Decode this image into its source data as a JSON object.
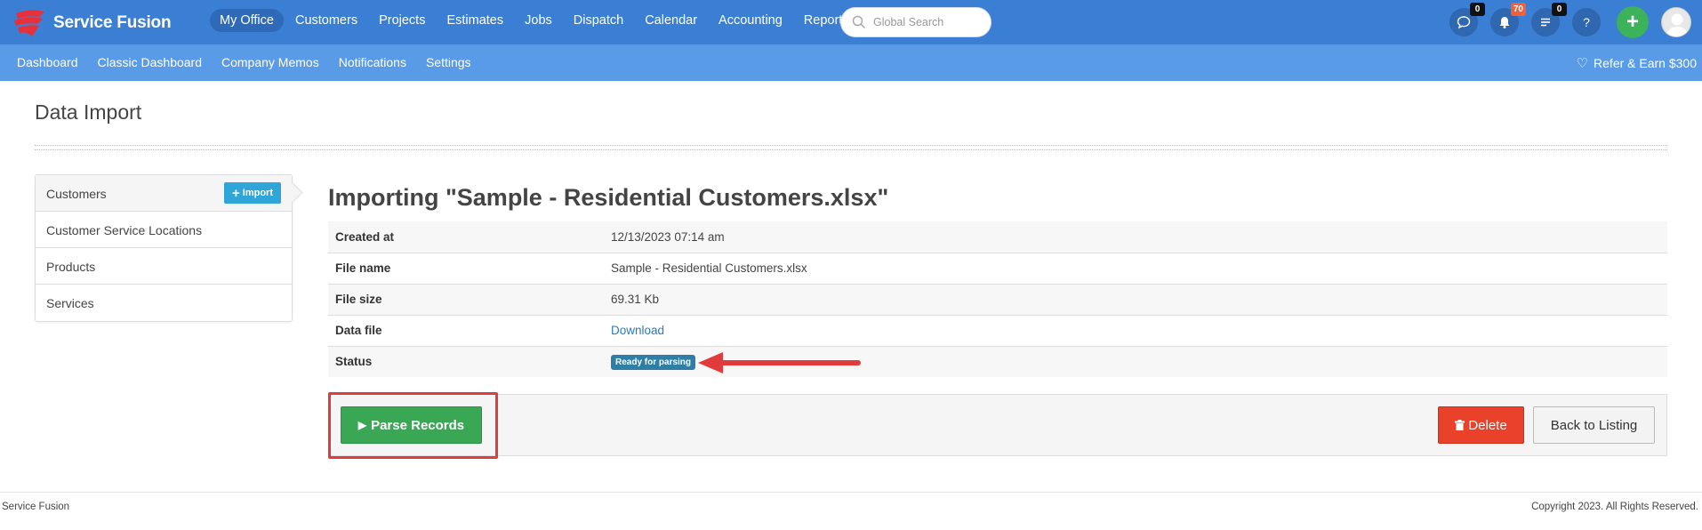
{
  "brand": {
    "name": "Service Fusion"
  },
  "main_nav": [
    {
      "label": "My Office",
      "active": true
    },
    {
      "label": "Customers"
    },
    {
      "label": "Projects"
    },
    {
      "label": "Estimates"
    },
    {
      "label": "Jobs"
    },
    {
      "label": "Dispatch"
    },
    {
      "label": "Calendar"
    },
    {
      "label": "Accounting"
    },
    {
      "label": "Reports"
    }
  ],
  "search": {
    "placeholder": "Global Search"
  },
  "header_icons": {
    "chat_count": "0",
    "notifications_count": "70",
    "tasks_count": "0",
    "help": "?",
    "add": "+"
  },
  "sub_nav": [
    "Dashboard",
    "Classic Dashboard",
    "Company Memos",
    "Notifications",
    "Settings"
  ],
  "refer": "Refer & Earn $300",
  "page_title": "Data Import",
  "sidebar": {
    "items": [
      "Customers",
      "Customer Service Locations",
      "Products",
      "Services"
    ],
    "import_label": "Import"
  },
  "main": {
    "title": "Importing \"Sample - Residential Customers.xlsx\"",
    "rows": [
      {
        "label": "Created at",
        "value": "12/13/2023 07:14 am"
      },
      {
        "label": "File name",
        "value": "Sample - Residential Customers.xlsx"
      },
      {
        "label": "File size",
        "value": "69.31 Kb"
      },
      {
        "label": "Data file",
        "value": "Download"
      },
      {
        "label": "Status",
        "value": "Ready for parsing"
      }
    ]
  },
  "actions": {
    "parse": "Parse Records",
    "delete": "Delete",
    "back": "Back to Listing"
  },
  "footer": {
    "left": "Service Fusion",
    "right": "Copyright 2023. All Rights Reserved."
  },
  "colors": {
    "topbar": "#3b7fd4",
    "subbar": "#5a9be8",
    "parse": "#3aa754",
    "delete": "#e9412a",
    "annotation": "#e23b3b"
  }
}
